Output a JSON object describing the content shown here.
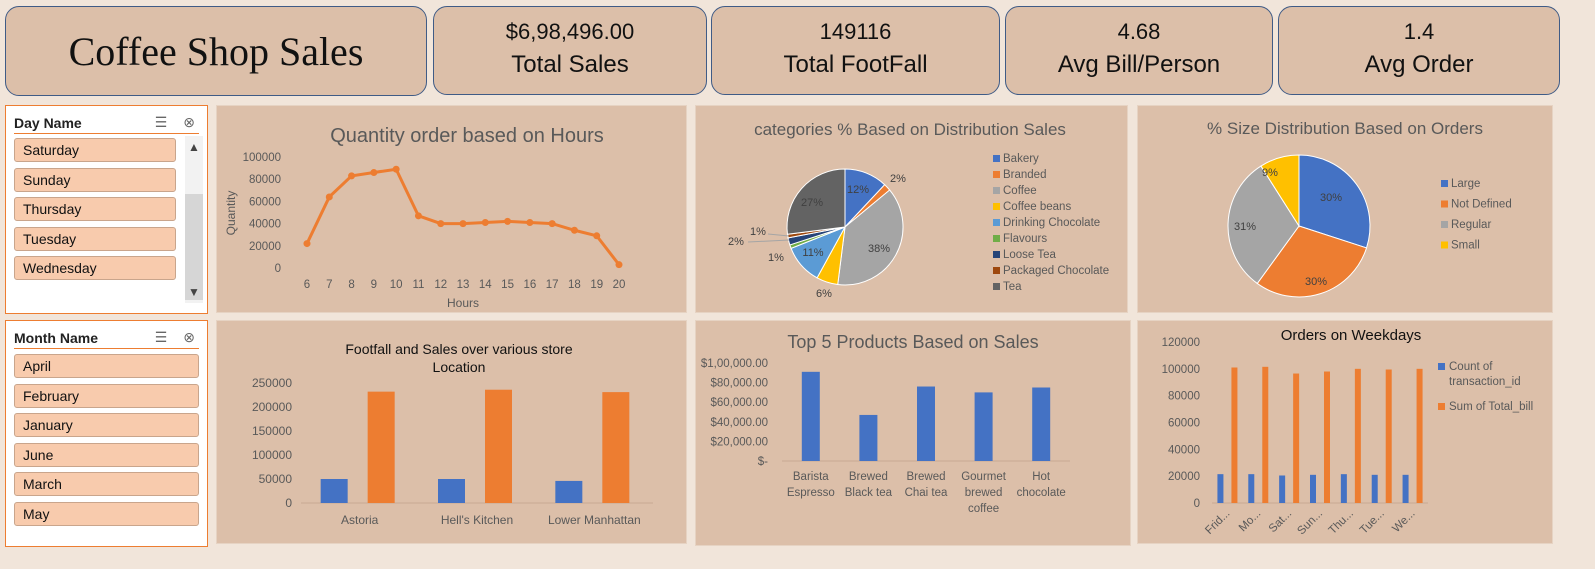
{
  "dashboard_title": "Coffee Shop Sales",
  "kpis": [
    {
      "value": "$6,98,496.00",
      "label": "Total Sales"
    },
    {
      "value": "149116",
      "label": "Total FootFall"
    },
    {
      "value": "4.68",
      "label": "Avg Bill/Person"
    },
    {
      "value": "1.4",
      "label": "Avg Order"
    }
  ],
  "slicers": {
    "day": {
      "title": "Day Name",
      "items": [
        "Saturday",
        "Sunday",
        "Thursday",
        "Tuesday",
        "Wednesday"
      ]
    },
    "month": {
      "title": "Month Name",
      "items": [
        "April",
        "February",
        "January",
        "June",
        "March",
        "May"
      ]
    }
  },
  "colors": {
    "blue": "#4472c4",
    "orange": "#ed7d31",
    "gray": "#a5a5a5",
    "yellow": "#ffc000"
  },
  "chart_data": [
    {
      "id": "hours",
      "type": "line",
      "title": "Quantity order based on Hours",
      "xlabel": "Hours",
      "ylabel": "Quantity",
      "x": [
        6,
        7,
        8,
        9,
        10,
        11,
        12,
        13,
        14,
        15,
        16,
        17,
        18,
        19,
        20
      ],
      "values": [
        22000,
        64000,
        83000,
        86000,
        89000,
        47000,
        40000,
        40000,
        41000,
        42000,
        41000,
        40000,
        34000,
        29000,
        3000
      ],
      "ylim": [
        0,
        100000
      ],
      "yticks": [
        "0",
        "20000",
        "40000",
        "60000",
        "80000",
        "100000"
      ]
    },
    {
      "id": "categories",
      "type": "pie",
      "title": "categories % Based on Distribution Sales",
      "slices": [
        {
          "name": "Bakery",
          "value": 12,
          "label": "12%",
          "color": "#4472c4"
        },
        {
          "name": "Branded",
          "value": 2,
          "label": "2%",
          "color": "#ed7d31"
        },
        {
          "name": "Coffee",
          "value": 38,
          "label": "38%",
          "color": "#a5a5a5"
        },
        {
          "name": "Coffee beans",
          "value": 6,
          "label": "6%",
          "color": "#ffc000"
        },
        {
          "name": "Drinking Chocolate",
          "value": 11,
          "label": "11%",
          "color": "#5b9bd5"
        },
        {
          "name": "Flavours",
          "value": 1,
          "label": "1%",
          "color": "#70ad47"
        },
        {
          "name": "Loose Tea",
          "value": 2,
          "label": "2%",
          "color": "#264478"
        },
        {
          "name": "Packaged Chocolate",
          "value": 1,
          "label": "1%",
          "color": "#9e480e"
        },
        {
          "name": "Tea",
          "value": 27,
          "label": "27%",
          "color": "#636363"
        }
      ]
    },
    {
      "id": "sizes",
      "type": "pie",
      "title": "% Size Distribution Based on Orders",
      "slices": [
        {
          "name": "Large",
          "value": 30,
          "label": "30%",
          "color": "#4472c4"
        },
        {
          "name": "Not Defined",
          "value": 30,
          "label": "30%",
          "color": "#ed7d31"
        },
        {
          "name": "Regular",
          "value": 31,
          "label": "31%",
          "color": "#a5a5a5"
        },
        {
          "name": "Small",
          "value": 9,
          "label": "9%",
          "color": "#ffc000"
        }
      ]
    },
    {
      "id": "stores",
      "type": "bar",
      "title": "Footfall and Sales over various store Location",
      "title_lines": [
        "Footfall and Sales over various store",
        "Location"
      ],
      "categories": [
        "Astoria",
        "Hell's Kitchen",
        "Lower Manhattan"
      ],
      "series": [
        {
          "values": [
            50000,
            50000,
            46000
          ],
          "color": "#4472c4"
        },
        {
          "values": [
            232000,
            236000,
            231000
          ],
          "color": "#ed7d31"
        }
      ],
      "ylim": [
        0,
        250000
      ],
      "yticks": [
        "0",
        "50000",
        "100000",
        "150000",
        "200000",
        "250000"
      ]
    },
    {
      "id": "products",
      "type": "bar",
      "title": "Top 5 Products Based on Sales",
      "categories": [
        [
          "Barista",
          "Espresso"
        ],
        [
          "Brewed",
          "Black tea"
        ],
        [
          "Brewed",
          "Chai tea"
        ],
        [
          "Gourmet",
          "brewed",
          "coffee"
        ],
        [
          "Hot",
          "chocolate"
        ]
      ],
      "values": [
        91000,
        47000,
        76000,
        70000,
        75000
      ],
      "ylim": [
        0,
        100000
      ],
      "yticks": [
        "$-",
        "$20,000.00",
        "$40,000.00",
        "$60,000.00",
        "$80,000.00",
        "$1,00,000.00"
      ]
    },
    {
      "id": "weekdays",
      "type": "bar",
      "title": "Orders on Weekdays",
      "categories": [
        "Frid...",
        "Mo...",
        "Sat...",
        "Sun...",
        "Thu...",
        "Tue...",
        "We..."
      ],
      "series": [
        {
          "name": "Count of transaction_id",
          "name_lines": [
            "Count of",
            "transaction_id"
          ],
          "values": [
            21500,
            21500,
            20500,
            21000,
            21500,
            21000,
            21000
          ],
          "color": "#4472c4"
        },
        {
          "name": "Sum of Total_bill",
          "name_lines": [
            "Sum of Total_bill"
          ],
          "values": [
            101000,
            101500,
            96500,
            98000,
            100000,
            99500,
            100000
          ],
          "color": "#ed7d31"
        }
      ],
      "ylim": [
        0,
        120000
      ],
      "yticks": [
        "0",
        "20000",
        "40000",
        "60000",
        "80000",
        "100000",
        "120000"
      ]
    }
  ]
}
